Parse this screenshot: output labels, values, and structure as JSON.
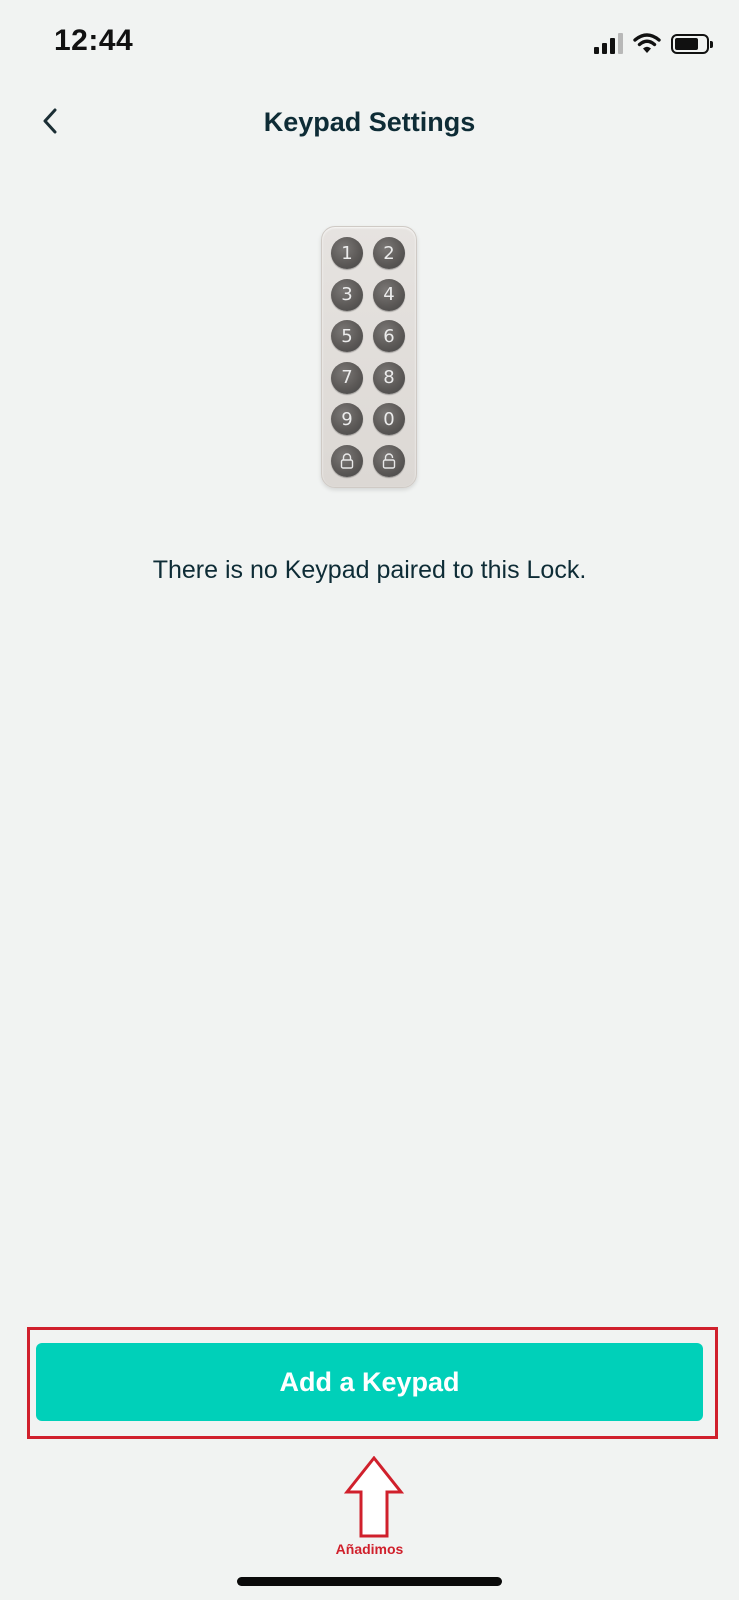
{
  "status_bar": {
    "time": "12:44",
    "battery_level": 0.75
  },
  "header": {
    "back_icon": "chevron-left-icon",
    "title": "Keypad Settings"
  },
  "keypad_illustration": {
    "keys": [
      "1",
      "2",
      "3",
      "4",
      "5",
      "6",
      "7",
      "8",
      "9",
      "0",
      "lock-icon",
      "unlock-icon"
    ]
  },
  "main": {
    "empty_message": "There is no Keypad paired to this Lock."
  },
  "actions": {
    "add_keypad_label": "Add a Keypad"
  },
  "annotation": {
    "label": "Añadimos",
    "color": "#d0202c"
  },
  "colors": {
    "accent": "#00d0b9",
    "text_primary": "#0e2c36",
    "background": "#f1f3f2"
  }
}
